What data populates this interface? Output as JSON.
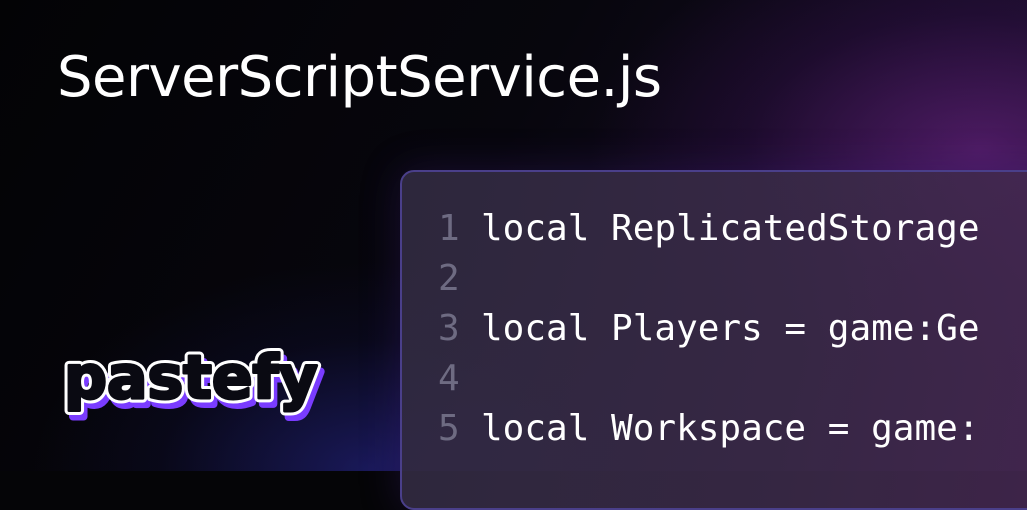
{
  "header": {
    "title": "ServerScriptService.js"
  },
  "brand": {
    "logo_text": "pastefy",
    "logo_fill": "#ffffff",
    "logo_outline": "#0a0a12",
    "logo_shadow": "#7a3cff"
  },
  "editor": {
    "lines": [
      {
        "number": "1",
        "text": "local ReplicatedStorage"
      },
      {
        "number": "2",
        "text": ""
      },
      {
        "number": "3",
        "text": "local Players = game:Ge"
      },
      {
        "number": "4",
        "text": ""
      },
      {
        "number": "5",
        "text": "local Workspace = game:"
      }
    ]
  },
  "colors": {
    "background": "#050507",
    "panel_border": "#4a3f8a",
    "line_number": "#6e6b82",
    "code_text": "#ffffff"
  }
}
